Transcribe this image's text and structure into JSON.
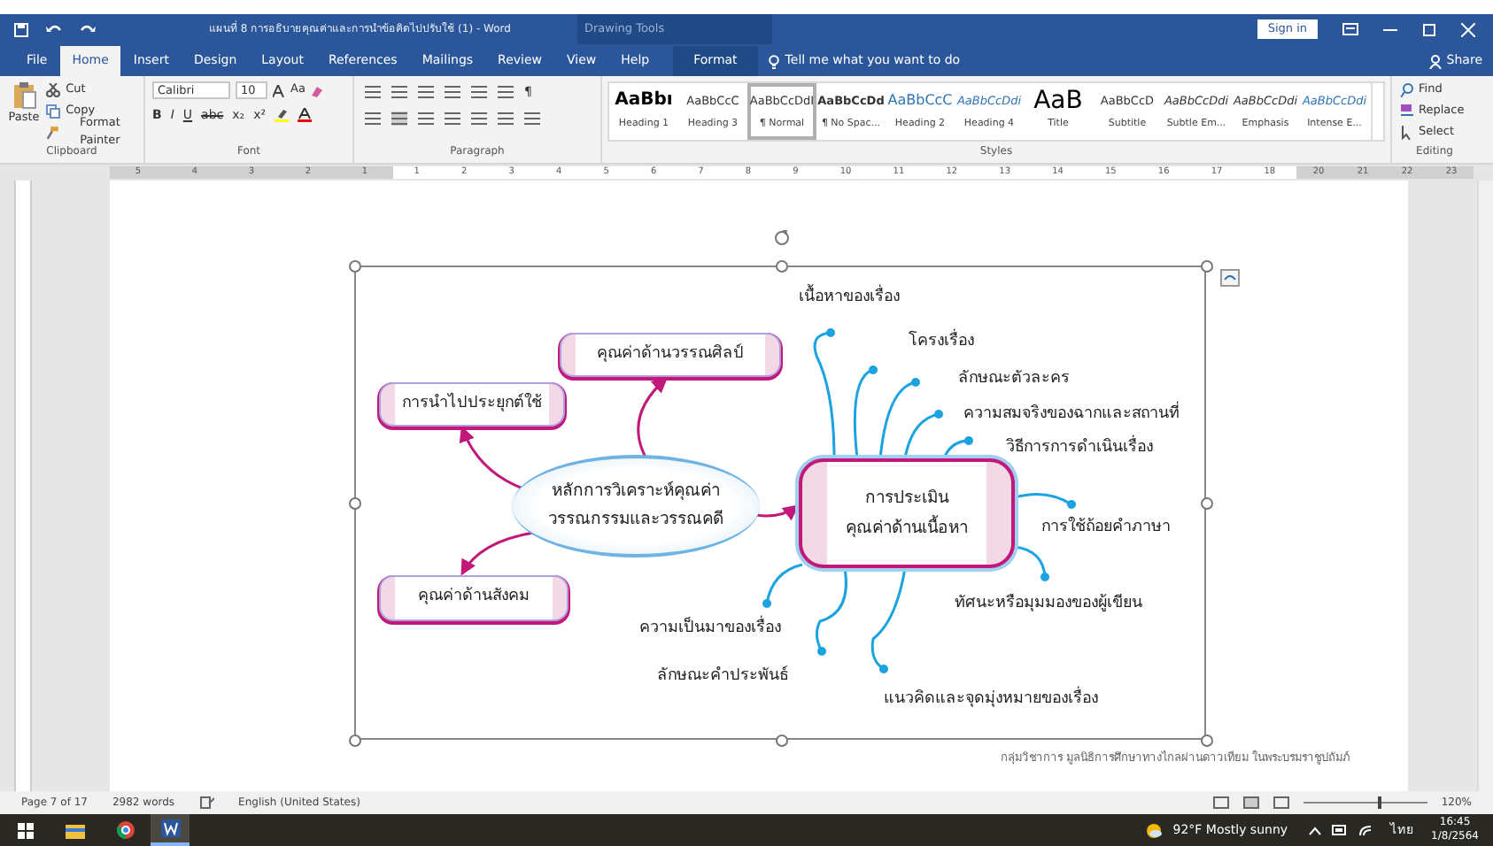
{
  "window": {
    "title": "แผนที่ 8 การอธิบายคุณค่าและการนำข้อคิดไปปรับใช้ (1)  -  Word",
    "context_label": "Drawing Tools",
    "sign_in": "Sign in"
  },
  "tabs": [
    {
      "label": "File",
      "selected": false
    },
    {
      "label": "Home",
      "selected": true
    },
    {
      "label": "Insert",
      "selected": false
    },
    {
      "label": "Design",
      "selected": false
    },
    {
      "label": "Layout",
      "selected": false
    },
    {
      "label": "References",
      "selected": false
    },
    {
      "label": "Mailings",
      "selected": false
    },
    {
      "label": "Review",
      "selected": false
    },
    {
      "label": "View",
      "selected": false
    },
    {
      "label": "Help",
      "selected": false
    },
    {
      "label": "Format",
      "selected": false
    }
  ],
  "tell_me": "Tell me what you want to do",
  "share": "Share",
  "clipboard": {
    "paste": "Paste",
    "items": [
      "Cut",
      "Copy",
      "Format Painter"
    ],
    "label": "Clipboard"
  },
  "font": {
    "name": "Calibri",
    "size": "10",
    "case_button": "Aa",
    "format_buttons": [
      "B",
      "I",
      "U",
      "abc",
      "x₂",
      "x²"
    ],
    "label": "Font"
  },
  "paragraph": {
    "label": "Paragraph",
    "marks_button": "¶"
  },
  "styles": {
    "label": "Styles",
    "items": [
      {
        "preview": "AaBbı",
        "name": "Heading 1",
        "kind": "heading",
        "selected": false
      },
      {
        "preview": "AaBbCcC",
        "name": "Heading 3",
        "kind": "plain",
        "selected": false
      },
      {
        "preview": "AaBbCcDdI",
        "name": "¶ Normal",
        "kind": "plain",
        "selected": true
      },
      {
        "preview": "AaBbCcDd",
        "name": "¶ No Spac...",
        "kind": "strong",
        "selected": false
      },
      {
        "preview": "AaBbCcC",
        "name": "Heading 2",
        "kind": "blue",
        "selected": false
      },
      {
        "preview": "AaBbCcDdi",
        "name": "Heading 4",
        "kind": "blue-italic",
        "selected": false
      },
      {
        "preview": "AaB",
        "name": "Title",
        "kind": "title",
        "selected": false
      },
      {
        "preview": "AaBbCcD",
        "name": "Subtitle",
        "kind": "plain",
        "selected": false
      },
      {
        "preview": "AaBbCcDdi",
        "name": "Subtle Em...",
        "kind": "italic",
        "selected": false
      },
      {
        "preview": "AaBbCcDdi",
        "name": "Emphasis",
        "kind": "italic",
        "selected": false
      },
      {
        "preview": "AaBbCcDdi",
        "name": "Intense E...",
        "kind": "blue-italic",
        "selected": false
      }
    ]
  },
  "editing": {
    "items": [
      "Find",
      "Replace",
      "Select"
    ],
    "label": "Editing"
  },
  "ruler": {
    "left_marks": [
      "5",
      "4",
      "3",
      "2",
      "1"
    ],
    "marks": [
      "1",
      "2",
      "3",
      "4",
      "5",
      "6",
      "7",
      "8",
      "9",
      "10",
      "11",
      "12",
      "13",
      "14",
      "15",
      "16",
      "17",
      "18"
    ],
    "right_marks": [
      "20",
      "21",
      "22",
      "23"
    ]
  },
  "diagram": {
    "center": "หลักการวิเคราะห์คุณค่า\nวรรณกรรมและวรรณคดี",
    "branches": [
      {
        "label": "คุณค่าด้านวรรณศิลป์",
        "kind": "box"
      },
      {
        "label": "การนำไปประยุกต์ใช้",
        "kind": "box"
      },
      {
        "label": "คุณค่าด้านสังคม",
        "kind": "box"
      },
      {
        "label": "การประเมิน\nคุณค่าด้านเนื้อหา",
        "kind": "hub"
      }
    ],
    "leaves": [
      {
        "label": "เนื้อหาของเรื่อง"
      },
      {
        "label": "โครงเรื่อง"
      },
      {
        "label": "ลักษณะตัวละคร"
      },
      {
        "label": "ความสมจริงของฉากและสถานที่"
      },
      {
        "label": "วิธีการการดำเนินเรื่อง"
      },
      {
        "label": "การใช้ถ้อยคำภาษา"
      },
      {
        "label": "ทัศนะหรือมุมมองของผู้เขียน"
      },
      {
        "label": "ความเป็นมาของเรื่อง"
      },
      {
        "label": "ลักษณะคำประพันธ์"
      },
      {
        "label": "แนวคิดและจุดมุ่งหมายของเรื่อง"
      }
    ]
  },
  "footer_text": "กลุ่มวิชาการ มูลนิธิการศึกษาทางไกลผ่านดาวเทียม ในพระบรมราชูปถัมภ์",
  "status_bar": {
    "page": "Page 7 of 17",
    "words": "2982 words",
    "language": "English (United States)",
    "zoom": "120%",
    "level": 0.6
  },
  "taskbar": {
    "weather": "92°F  Mostly sunny",
    "input_language": "ไทย",
    "time": "16:45",
    "date": "1/8/2564"
  }
}
